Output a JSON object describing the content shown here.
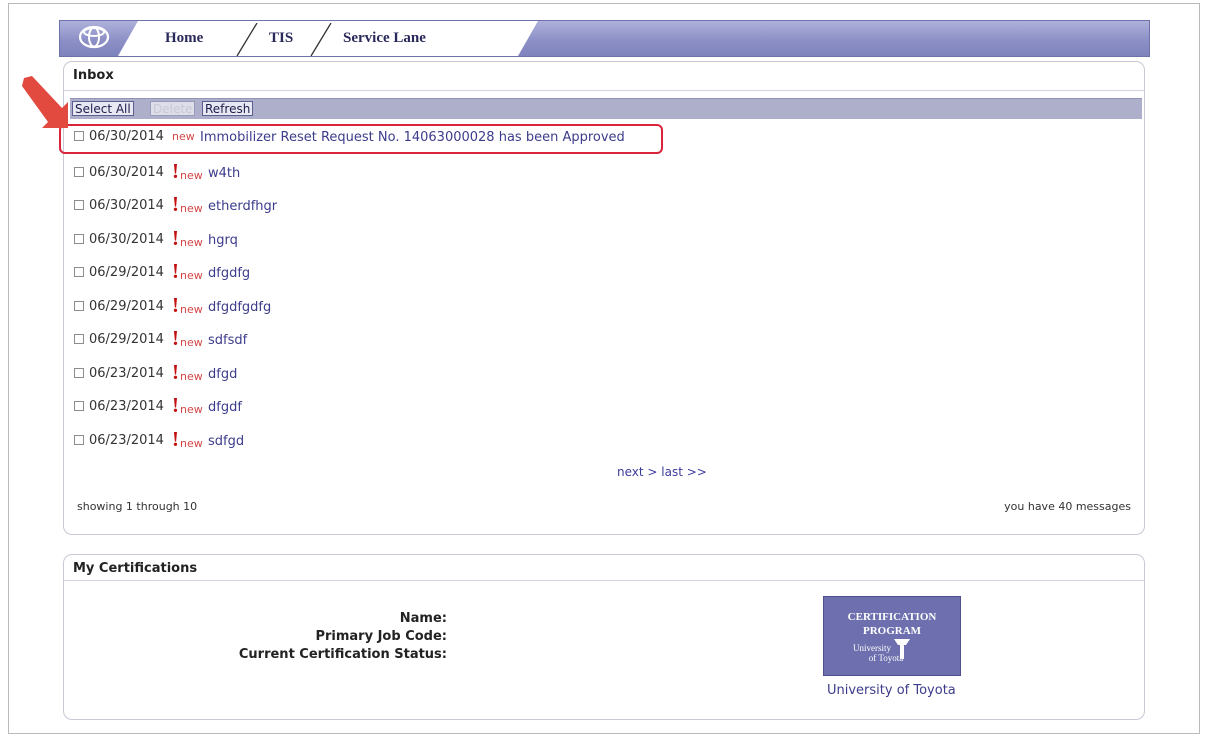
{
  "nav": {
    "tabs": [
      {
        "label": "Home"
      },
      {
        "label": "TIS"
      },
      {
        "label": "Service Lane"
      }
    ]
  },
  "inbox": {
    "title": "Inbox",
    "toolbar": {
      "select_all": "Select All",
      "delete": "Delete",
      "refresh": "Refresh"
    },
    "messages": [
      {
        "date": "06/30/2014",
        "flag": "new",
        "subject": "Immobilizer Reset Request No. 14063000028 has been Approved",
        "urgent": false
      },
      {
        "date": "06/30/2014",
        "flag": "new",
        "subject": "w4th",
        "urgent": true
      },
      {
        "date": "06/30/2014",
        "flag": "new",
        "subject": "etherdfhgr",
        "urgent": true
      },
      {
        "date": "06/30/2014",
        "flag": "new",
        "subject": "hgrq",
        "urgent": true
      },
      {
        "date": "06/29/2014",
        "flag": "new",
        "subject": "dfgdfg",
        "urgent": true
      },
      {
        "date": "06/29/2014",
        "flag": "new",
        "subject": "dfgdfgdfg",
        "urgent": true
      },
      {
        "date": "06/29/2014",
        "flag": "new",
        "subject": "sdfsdf",
        "urgent": true
      },
      {
        "date": "06/23/2014",
        "flag": "new",
        "subject": "dfgd",
        "urgent": true
      },
      {
        "date": "06/23/2014",
        "flag": "new",
        "subject": "dfgdf",
        "urgent": true
      },
      {
        "date": "06/23/2014",
        "flag": "new",
        "subject": "sdfgd",
        "urgent": true
      }
    ],
    "urgent_mark": "!",
    "pager": "next > last >>",
    "showing": "showing 1 through 10",
    "total": "you have 40 messages"
  },
  "certifications": {
    "title": "My Certifications",
    "name_label": "Name:",
    "job_code_label": "Primary Job Code:",
    "status_label": "Current Certification Status:",
    "logo_line1": "CERTIFICATION",
    "logo_line2": "PROGRAM",
    "logo_line3": "University",
    "logo_line4": "of Toyota",
    "logo_caption": "University of Toyota"
  },
  "colors": {
    "nav_bar": "#8c90c6",
    "toolbar": "#aeafcb",
    "link": "#3c3c8c",
    "new_flag": "#d64646",
    "urgent": "#c31212",
    "callout": "#d9243c"
  },
  "icons": {
    "brand": "toyota-logo-icon",
    "callout": "red-arrow-icon",
    "urgent": "exclamation-icon"
  }
}
